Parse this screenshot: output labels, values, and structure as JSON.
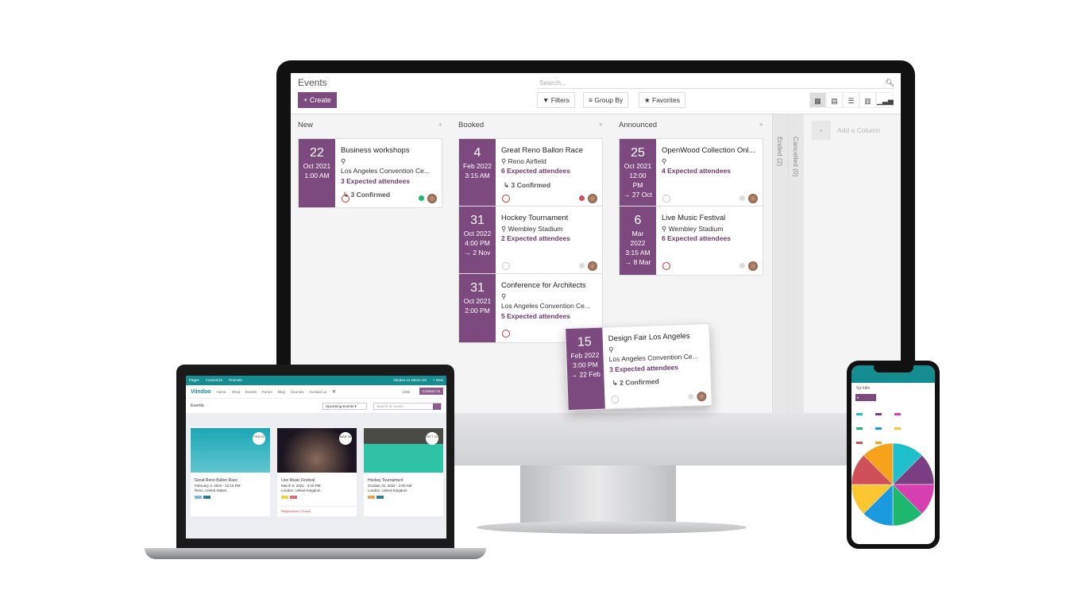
{
  "monitor": {
    "title": "Events",
    "create_label": "Create",
    "search_placeholder": "Search...",
    "filters_label": "Filters",
    "groupby_label": "Group By",
    "favorites_label": "Favorites",
    "views": [
      "kanban-icon",
      "calendar-icon",
      "list-icon",
      "grid-icon",
      "graph-icon"
    ],
    "accent": "#7c4a7e",
    "columns": [
      {
        "name": "New",
        "cards": [
          {
            "day": "22",
            "lines": [
              "Oct 2021",
              "1:00 AM"
            ],
            "name": "Business workshops",
            "loc": "",
            "loc2": "Los Angeles Convention Ce...",
            "att": "3 Expected attendees",
            "conf": "↳ 3 Confirmed",
            "clock": "red",
            "dot": "#1db86d"
          }
        ]
      },
      {
        "name": "Booked",
        "cards": [
          {
            "day": "4",
            "lines": [
              "Feb 2022",
              "3:15 AM"
            ],
            "name": "Great Reno Ballon Race",
            "loc": "Reno Airfield",
            "loc2": "",
            "att": "6 Expected attendees",
            "conf": "↳ 3 Confirmed",
            "clock": "red",
            "dot": "#d0505a"
          },
          {
            "day": "31",
            "lines": [
              "Oct 2022",
              "4:00 PM",
              "→ 2 Nov"
            ],
            "name": "Hockey Tournament",
            "loc": "Wembley Stadium",
            "loc2": "",
            "att": "2 Expected attendees",
            "conf": "",
            "clock": "grey",
            "dot": "#ddd"
          },
          {
            "day": "31",
            "lines": [
              "Oct 2021",
              "2:00 PM"
            ],
            "name": "Conference for Architects",
            "loc": "",
            "loc2": "Los Angeles Convention Ce...",
            "att": "5 Expected attendees",
            "conf": "",
            "clock": "red",
            "dot": ""
          }
        ]
      },
      {
        "name": "Announced",
        "cards": [
          {
            "day": "25",
            "lines": [
              "Oct 2021",
              "12:00",
              "PM",
              "→ 27 Oct"
            ],
            "name": "OpenWood Collection Onl...",
            "loc": "",
            "loc2": "",
            "att": "4 Expected attendees",
            "conf": "",
            "clock": "grey",
            "dot": "#ddd"
          },
          {
            "day": "6",
            "lines": [
              "Mar",
              "2022",
              "3:15 AM",
              "→ 8 Mar"
            ],
            "name": "Live Music Festival",
            "loc": "Wembley Stadium",
            "loc2": "",
            "att": "6 Expected attendees",
            "conf": "",
            "clock": "red",
            "dot": "#ddd"
          }
        ]
      }
    ],
    "folded": [
      "Ended (2)",
      "Cancelled (0)"
    ],
    "add_column": "Add a Column",
    "dragged_card": {
      "day": "15",
      "lines": [
        "Feb 2022",
        "3:00 PM",
        "→ 22 Feb"
      ],
      "name": "Design Fair Los Angeles",
      "loc": "",
      "loc2": "Los Angeles Convention Ce...",
      "att": "3 Expected attendees",
      "conf": "↳ 2 Confirmed",
      "clock": "grey",
      "dot": "#ddd"
    }
  },
  "laptop": {
    "topbar": [
      "Pages",
      "Customize",
      "Promote"
    ],
    "topbar_right": [
      "Viindoo 14 Demo US",
      "+ New"
    ],
    "logo": "Viindoo",
    "nav": [
      "Home",
      "Shop",
      "Events",
      "Forum",
      "Blog",
      "Courses",
      "Contact us"
    ],
    "currency": "USD",
    "contact_button": "Contact Us",
    "page_title": "Events",
    "filter": "Upcoming Events",
    "search_placeholder": "Search an event...",
    "events": [
      {
        "badge": "FEB 03",
        "name": "Great Reno Ballon Race",
        "date": "February 3, 2022 - 12:15 PM",
        "place": "Reno, United States",
        "tags": [
          "#7fb7d6",
          "#2f7f8f"
        ],
        "img": "linear-gradient(#1aa6b5,#62c6cf)",
        "register": ""
      },
      {
        "badge": "MAR 05",
        "name": "Live Music Festival",
        "date": "March 5, 2022 - 3:15 PM",
        "place": "London, United Kingdom",
        "tags": [
          "#e8d64a",
          "#e06a7a"
        ],
        "img": "radial-gradient(circle at 50% 70%,#8a6a5a,#1a1520 70%)",
        "register": "Registrations Closed"
      },
      {
        "badge": "OCT 31",
        "name": "Hockey Tournament",
        "date": "October 31, 2022 - 2:00 AM",
        "place": "London, United Kingdom",
        "tags": [
          "#e9a35c",
          "#2f7f8f"
        ],
        "img": "linear-gradient(#4b4b45 35%,#2fc3a6 36%)",
        "register": ""
      }
    ]
  },
  "phone": {
    "title": "Sự kiện"
  },
  "chart_data": {
    "type": "pie",
    "values": [
      1,
      1,
      1,
      1,
      1,
      1,
      1,
      1
    ],
    "colors": [
      "#1ebfca",
      "#7a3f83",
      "#d63fb0",
      "#1db86d",
      "#1c9ae0",
      "#fbc730",
      "#d0505a",
      "#f5a31a"
    ]
  }
}
